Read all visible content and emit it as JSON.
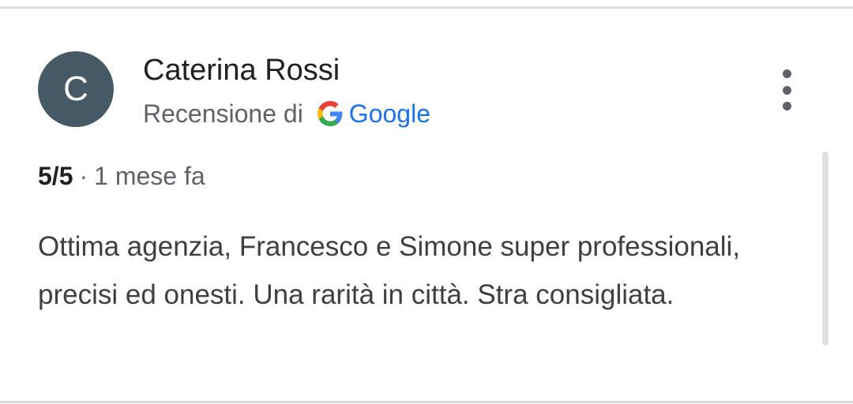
{
  "review": {
    "avatar_letter": "C",
    "author_name": "Caterina Rossi",
    "source_prefix": "Recensione di",
    "source_name": "Google",
    "rating": "5/5",
    "separator": "·",
    "time_ago": "1 mese fa",
    "text": "Ottima agenzia, Francesco e Simone super professionali, precisi ed onesti. Una rarità in città. Stra consigliata."
  },
  "icons": {
    "source_logo": "google-g-icon",
    "menu": "more-vert-icon"
  },
  "colors": {
    "avatar_bg": "#455a64",
    "google_blue": "#1a73e8",
    "secondary_text": "#5f6368"
  }
}
